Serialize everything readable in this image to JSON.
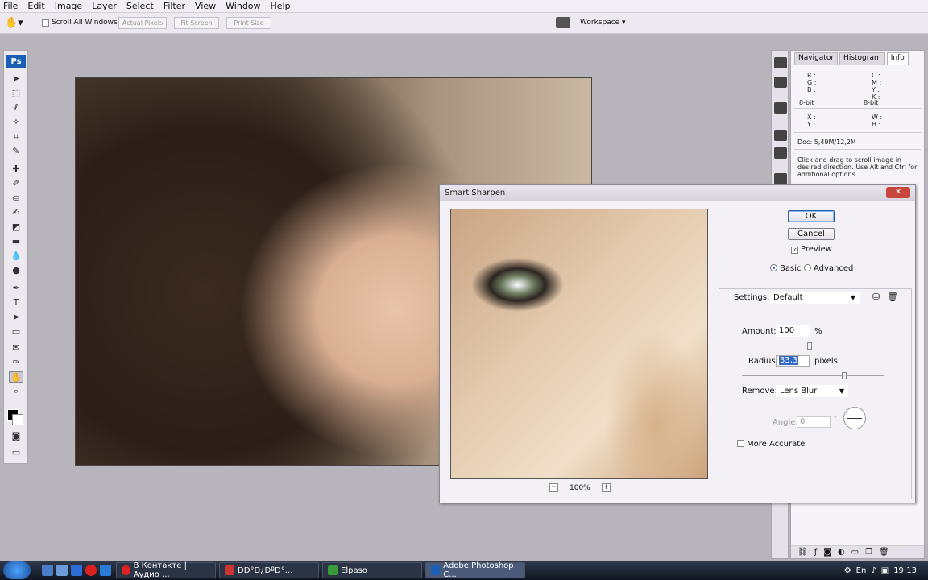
{
  "menu": [
    "File",
    "Edit",
    "Image",
    "Layer",
    "Select",
    "Filter",
    "View",
    "Window",
    "Help"
  ],
  "options": {
    "scroll_all_windows": "Scroll All Windows",
    "actual_pixels": "Actual Pixels",
    "fit_screen": "Fit Screen",
    "print_size": "Print Size",
    "workspace": "Workspace ▾"
  },
  "tools": {
    "logo": "Ps"
  },
  "panel": {
    "tabs": [
      "Navigator",
      "Histogram",
      "Info"
    ],
    "info": {
      "rgb": "R :\nG :\nB :",
      "cmyk": "C :\nM :\nY :\nK :",
      "bit_left": "8-bit",
      "bit_right": "8-bit",
      "xy": "X :\nY :",
      "wh": "W :\nH :",
      "doc": "Doc: 5,49M/12,2M",
      "hint": "Click and drag to scroll image in desired direction.  Use Alt and Ctrl for additional options"
    }
  },
  "dialog": {
    "title": "Smart Sharpen",
    "ok": "OK",
    "cancel": "Cancel",
    "preview": "Preview",
    "basic": "Basic",
    "advanced": "Advanced",
    "settings_label": "Settings:",
    "settings_value": "Default",
    "amount_label": "Amount:",
    "amount_value": "100",
    "amount_unit": "%",
    "radius_label": "Radius:",
    "radius_value": "33,3",
    "radius_unit": "pixels",
    "remove_label": "Remove:",
    "remove_value": "Lens Blur",
    "angle_label": "Angle:",
    "angle_value": "0",
    "more_accurate": "More Accurate",
    "zoom": "100%",
    "amount_fraction": 0.48,
    "radius_fraction": 0.72
  },
  "taskbar": {
    "tasks": [
      "В Контакте | Аудио ...",
      "ÐÐ°Ð¿ÐºÐ°...",
      "Elpaso",
      "Adobe Photoshop C..."
    ],
    "lang": "En",
    "time": "19:13"
  }
}
